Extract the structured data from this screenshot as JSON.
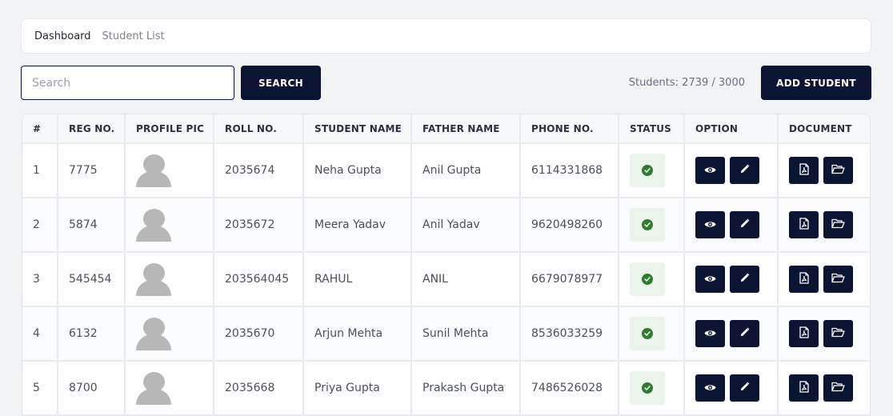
{
  "breadcrumb": {
    "home": "Dashboard",
    "current": "Student List"
  },
  "search": {
    "placeholder": "Search",
    "value": "",
    "button_label": "SEARCH"
  },
  "student_count": "Students: 2739 / 3000",
  "add_button_label": "ADD STUDENT",
  "colors": {
    "primary": "#0b1433",
    "status_active": "#2e7d32",
    "status_bg": "#eaf4ea"
  },
  "table": {
    "headers": [
      "#",
      "REG NO.",
      "PROFILE PIC",
      "ROLL NO.",
      "STUDENT NAME",
      "FATHER NAME",
      "PHONE NO.",
      "STATUS",
      "OPTION",
      "DOCUMENT"
    ],
    "rows": [
      {
        "index": "1",
        "reg_no": "7775",
        "roll_no": "2035674",
        "student_name": "Neha Gupta",
        "father_name": "Anil Gupta",
        "phone": "6114331868",
        "status": "active"
      },
      {
        "index": "2",
        "reg_no": "5874",
        "roll_no": "2035672",
        "student_name": "Meera Yadav",
        "father_name": "Anil Yadav",
        "phone": "9620498260",
        "status": "active"
      },
      {
        "index": "3",
        "reg_no": "545454",
        "roll_no": "203564045",
        "student_name": "RAHUL",
        "father_name": "ANIL",
        "phone": "6679078977",
        "status": "active"
      },
      {
        "index": "4",
        "reg_no": "6132",
        "roll_no": "2035670",
        "student_name": "Arjun Mehta",
        "father_name": "Sunil Mehta",
        "phone": "8536033259",
        "status": "active"
      },
      {
        "index": "5",
        "reg_no": "8700",
        "roll_no": "2035668",
        "student_name": "Priya Gupta",
        "father_name": "Prakash Gupta",
        "phone": "7486526028",
        "status": "active"
      }
    ],
    "row_icons": {
      "status": "check-circle-icon",
      "option": [
        "eye-icon",
        "pencil-icon"
      ],
      "document": [
        "pdf-file-icon",
        "folder-open-icon"
      ]
    }
  }
}
